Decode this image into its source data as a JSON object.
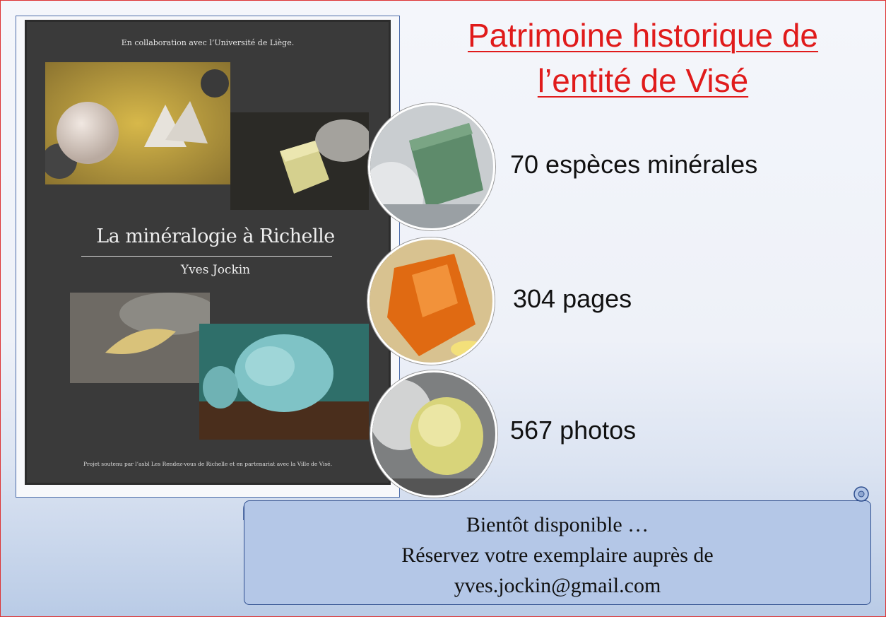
{
  "title": {
    "line1": "Patrimoine historique de",
    "line2": "l’entité de Visé"
  },
  "book": {
    "collaboration": "En collaboration avec l’Université de Liège.",
    "title": "La minéralogie à Richelle",
    "author": "Yves Jockin",
    "footer": "Projet soutenu par l’asbl Les Rendez-vous de Richelle et en partenariat avec la Ville de Visé."
  },
  "stats": [
    {
      "label": "70 espèces minérales",
      "icon": "green-mineral-photo"
    },
    {
      "label": "304 pages",
      "icon": "orange-mineral-photo"
    },
    {
      "label": "567 photos",
      "icon": "yellow-mineral-photo"
    }
  ],
  "banner": {
    "line1": "Bientôt disponible …",
    "line2": "Réservez votre exemplaire auprès de",
    "line3": "yves.jockin@gmail.com"
  },
  "colors": {
    "title": "#e01b1b",
    "banner_fill": "#b4c7e7",
    "banner_border": "#2f4f8f",
    "book_cover": "#3a3a3a"
  }
}
